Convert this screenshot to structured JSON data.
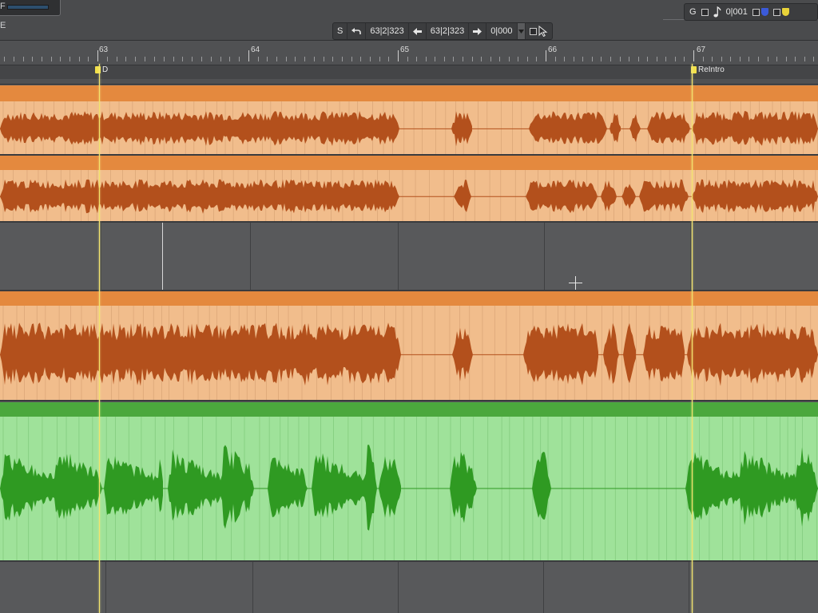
{
  "top": {
    "left_glyph_1": "F",
    "left_glyph_2": "E"
  },
  "transport": {
    "mode": "S",
    "undo_icon": "undo-arrow-icon",
    "left_locator": "63|2|323",
    "right_locator": "63|2|323",
    "offset": "0|000",
    "back_icon": "arrow-left-icon",
    "forward_icon": "arrow-right-icon"
  },
  "status": {
    "g_label": "G",
    "note_icon": "eighth-note-icon",
    "counter": "0|001",
    "shield_color_1": "#3b5ad8",
    "shield_color_2": "#e9d339"
  },
  "ruler": {
    "bars": [
      "63",
      "64",
      "65",
      "66",
      "67"
    ]
  },
  "markers": [
    {
      "label": "D"
    },
    {
      "label": "ReIntro"
    }
  ],
  "colors": {
    "orange_region": "#f1bd8c",
    "orange_header": "#e4893e",
    "orange_wave": "#b3501c",
    "green_region": "#9fe29a",
    "green_header": "#4ba83d",
    "green_wave": "#2f9a22",
    "playhead": "#f3e36a",
    "empty_track": "#58595b"
  }
}
